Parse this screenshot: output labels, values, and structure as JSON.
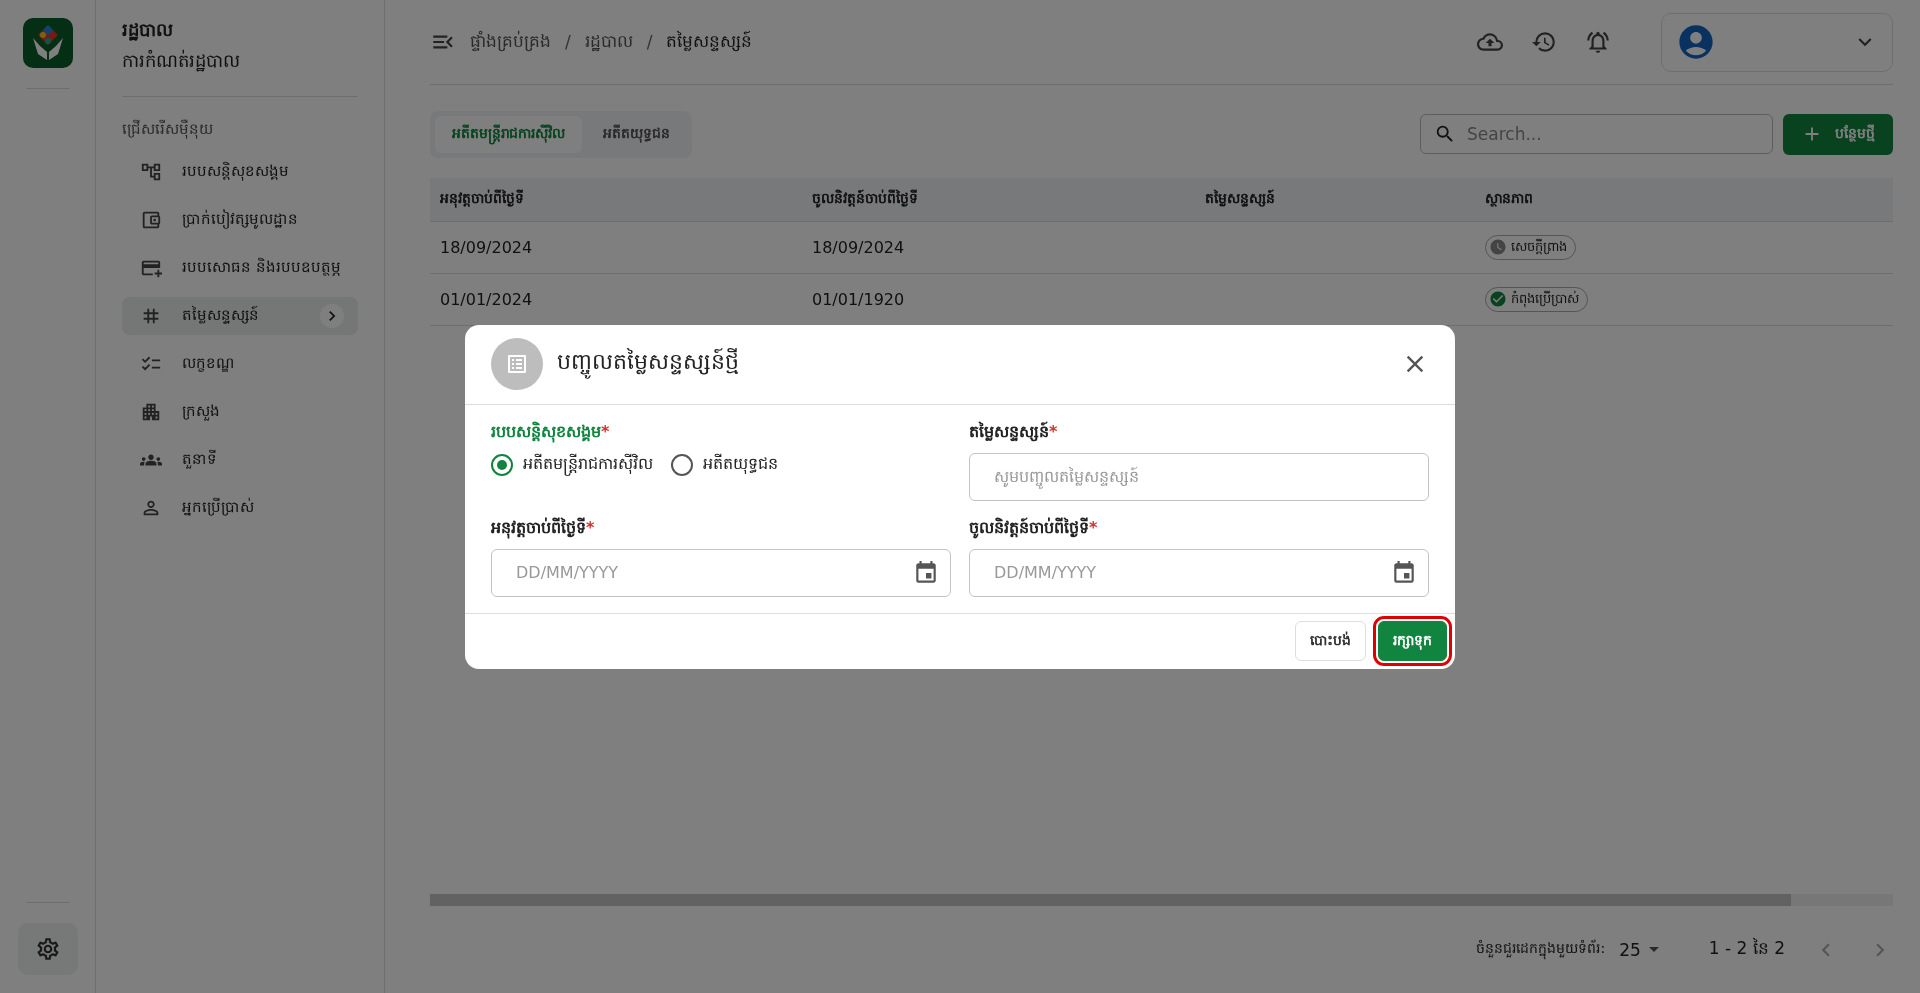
{
  "app": {
    "title": "រដ្ឋបាល",
    "subtitle": "ការកំណត់រដ្ឋបាល"
  },
  "sidebar": {
    "section": "ជ្រើសរើសម៉ឺនុយ",
    "items": [
      {
        "label": "របបសន្តិសុខសង្គម",
        "selected": false
      },
      {
        "label": "ប្រាក់បៀវត្សមូលដ្ឋាន",
        "selected": false
      },
      {
        "label": "របបសោធន និងរបបឧបត្ថម្ភ",
        "selected": false
      },
      {
        "label": "តម្លៃសន្ទស្សន៍",
        "selected": true
      },
      {
        "label": "លក្ខខណ្ឌ",
        "selected": false
      },
      {
        "label": "ក្រសួង",
        "selected": false
      },
      {
        "label": "តួនាទី",
        "selected": false
      },
      {
        "label": "អ្នកប្រើប្រាស់",
        "selected": false
      }
    ]
  },
  "breadcrumb": {
    "separator": "/",
    "items": [
      "ផ្ទាំងគ្រប់គ្រង",
      "រដ្ឋបាល",
      "តម្លៃសន្ទស្សន៍"
    ]
  },
  "tabs": [
    {
      "label": "អតីតមន្ត្រីរាជការស៊ីវិល",
      "selected": true
    },
    {
      "label": "អតីតយុទ្ធជន",
      "selected": false
    }
  ],
  "search": {
    "placeholder": "Search..."
  },
  "add_button": "បន្ថែមថ្មី",
  "table": {
    "columns": [
      "អនុវត្តចាប់ពីថ្ងៃទី",
      "ចូលនិវត្តន៍ចាប់ពីថ្ងៃទី",
      "តម្លៃសន្ទស្សន៍",
      "ស្ថានភាព"
    ],
    "rows": [
      {
        "cells": [
          "18/09/2024",
          "18/09/2024"
        ],
        "status": {
          "label": "សេចក្តីព្រាង",
          "kind": "draft"
        }
      },
      {
        "cells": [
          "01/01/2024",
          "01/01/1920"
        ],
        "status": {
          "label": "កំពុងប្រើប្រាស់",
          "kind": "active"
        }
      }
    ]
  },
  "pagination": {
    "rows_label": "ចំនួនជួរដេកក្នុងមួយទំព័រ:",
    "rows_value": "25",
    "range": "1 - 2 នៃ 2"
  },
  "dialog": {
    "title": "បញ្ចូលតម្លៃសន្ទស្សន៍ថ្មី",
    "scheme": {
      "label": "របបសន្តិសុខសង្គម",
      "required_mark": "*",
      "options": [
        {
          "label": "អតីតមន្ត្រីរាជការស៊ីវិល",
          "selected": true
        },
        {
          "label": "អតីតយុទ្ធជន",
          "selected": false
        }
      ]
    },
    "fields": [
      {
        "kind": "text",
        "label": "តម្លៃសន្ទស្សន៍",
        "required_mark": "*",
        "placeholder": "សូមបញ្ចូលតម្លៃសន្ទស្សន៍"
      },
      {
        "kind": "date",
        "label": "អនុវត្តចាប់ពីថ្ងៃទី",
        "required_mark": "*",
        "placeholder": "DD/MM/YYYY"
      },
      {
        "kind": "date",
        "label": "ចូលនិវត្តន៍ចាប់ពីថ្ងៃទី",
        "required_mark": "*",
        "placeholder": "DD/MM/YYYY"
      }
    ],
    "buttons": [
      {
        "kind": "cancel",
        "label": "បោះបង់",
        "highlighted": false
      },
      {
        "kind": "save",
        "label": "រក្សាទុក",
        "highlighted": true
      }
    ]
  }
}
